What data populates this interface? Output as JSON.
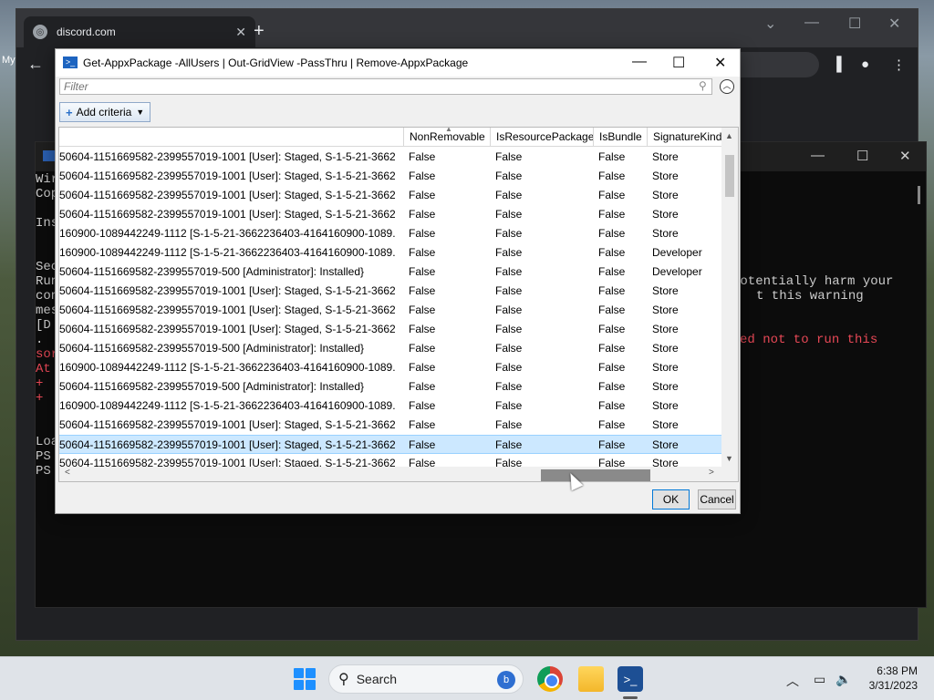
{
  "browser": {
    "tab_title": "discord.com",
    "new_tab": "+",
    "left_edge_text": "My"
  },
  "console": {
    "lines": [
      {
        "text": "Wir",
        "color": "normal"
      },
      {
        "text": "Cop",
        "color": "normal"
      },
      {
        "text": "Ins",
        "color": "normal"
      },
      {
        "text": "Sec",
        "color": "normal"
      },
      {
        "text": "Run",
        "color": "normal"
      },
      {
        "text": "con",
        "color": "normal"
      },
      {
        "text": "mes",
        "color": "normal"
      },
      {
        "text": "[D",
        "color": "normal"
      },
      {
        "text": ". ",
        "color": "normal"
      },
      {
        "text": "sor",
        "color": "red"
      },
      {
        "text": "At",
        "color": "red"
      },
      {
        "text": "+",
        "color": "red"
      },
      {
        "text": "+",
        "color": "red"
      },
      {
        "text": "Loa",
        "color": "normal"
      },
      {
        "text": "PS",
        "color": "normal"
      },
      {
        "text": "PS",
        "color": "normal"
      }
    ],
    "right_fragments": [
      {
        "text": "potentially harm your",
        "color": "normal"
      },
      {
        "text": "t this warning",
        "color": "normal"
      },
      {
        "text": "ed not to run this",
        "color": "red"
      }
    ]
  },
  "gridview": {
    "title": "Get-AppxPackage -AllUsers | Out-GridView -PassThru | Remove-AppxPackage",
    "filter_placeholder": "Filter",
    "add_criteria": "Add criteria",
    "columns": [
      "",
      "NonRemovable",
      "IsResourcePackage",
      "IsBundle",
      "SignatureKind"
    ],
    "rows": [
      [
        "50604-1151669582-2399557019-1001 [User]: Staged, S-1-5-21-3662...",
        "False",
        "False",
        "False",
        "Store"
      ],
      [
        "50604-1151669582-2399557019-1001 [User]: Staged, S-1-5-21-3662...",
        "False",
        "False",
        "False",
        "Store"
      ],
      [
        "50604-1151669582-2399557019-1001 [User]: Staged, S-1-5-21-3662...",
        "False",
        "False",
        "False",
        "Store"
      ],
      [
        "50604-1151669582-2399557019-1001 [User]: Staged, S-1-5-21-3662...",
        "False",
        "False",
        "False",
        "Store"
      ],
      [
        "160900-1089442249-1112 [S-1-5-21-3662236403-4164160900-1089...",
        "False",
        "False",
        "False",
        "Store"
      ],
      [
        "160900-1089442249-1112 [S-1-5-21-3662236403-4164160900-1089...",
        "False",
        "False",
        "False",
        "Developer"
      ],
      [
        "50604-1151669582-2399557019-500 [Administrator]: Installed}",
        "False",
        "False",
        "False",
        "Developer"
      ],
      [
        "50604-1151669582-2399557019-1001 [User]: Staged, S-1-5-21-3662...",
        "False",
        "False",
        "False",
        "Store"
      ],
      [
        "50604-1151669582-2399557019-1001 [User]: Staged, S-1-5-21-3662...",
        "False",
        "False",
        "False",
        "Store"
      ],
      [
        "50604-1151669582-2399557019-1001 [User]: Staged, S-1-5-21-3662...",
        "False",
        "False",
        "False",
        "Store"
      ],
      [
        "50604-1151669582-2399557019-500 [Administrator]: Installed}",
        "False",
        "False",
        "False",
        "Store"
      ],
      [
        "160900-1089442249-1112 [S-1-5-21-3662236403-4164160900-1089...",
        "False",
        "False",
        "False",
        "Store"
      ],
      [
        "50604-1151669582-2399557019-500 [Administrator]: Installed}",
        "False",
        "False",
        "False",
        "Store"
      ],
      [
        "160900-1089442249-1112 [S-1-5-21-3662236403-4164160900-1089...",
        "False",
        "False",
        "False",
        "Store"
      ],
      [
        "50604-1151669582-2399557019-1001 [User]: Staged, S-1-5-21-3662...",
        "False",
        "False",
        "False",
        "Store"
      ],
      [
        "50604-1151669582-2399557019-1001 [User]: Staged, S-1-5-21-3662...",
        "False",
        "False",
        "False",
        "Store"
      ],
      [
        "50604-1151669582-2399557019-1001 [User]: Staged, S-1-5-21-3662...",
        "False",
        "False",
        "False",
        "Store"
      ]
    ],
    "selected_row": 15,
    "ok_label": "OK",
    "cancel_label": "Cancel"
  },
  "taskbar": {
    "search_label": "Search",
    "time": "6:38 PM",
    "date": "3/31/2023"
  },
  "colors": {
    "selection": "#cce8ff",
    "console_bg": "#0c0c0c",
    "console_red": "#e74856",
    "accent": "#0078d7"
  }
}
